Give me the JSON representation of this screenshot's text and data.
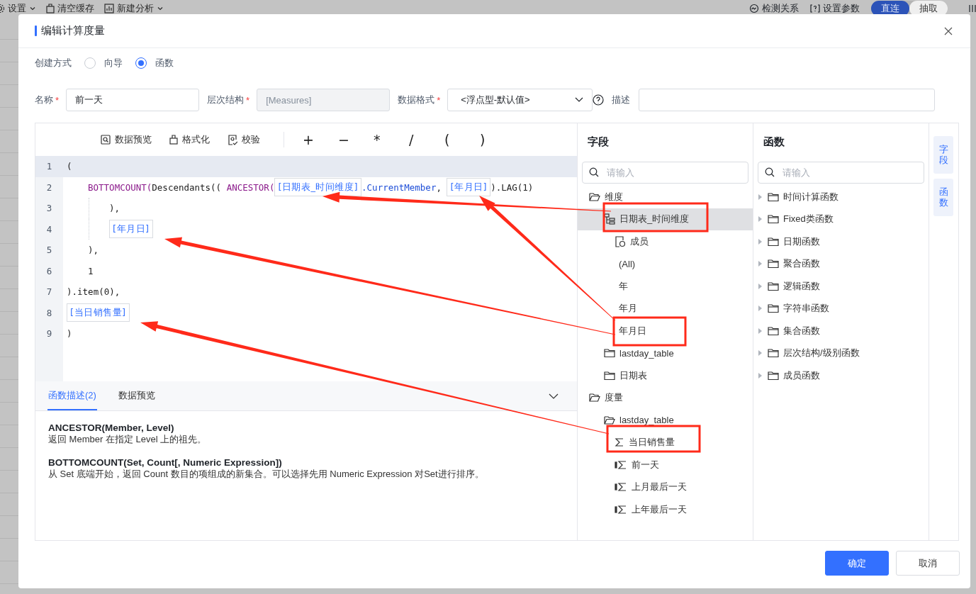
{
  "backdrop": {
    "toolbar_left": [
      {
        "label": "设置",
        "caret": true
      },
      {
        "label": "清空缓存",
        "caret": false
      },
      {
        "label": "新建分析",
        "caret": true
      }
    ],
    "toolbar_right": [
      {
        "label": "检测关系"
      },
      {
        "label": "设置参数"
      }
    ],
    "mode_toggle": [
      {
        "label": "直连",
        "selected": true
      },
      {
        "label": "抽取",
        "selected": false
      }
    ]
  },
  "dialog": {
    "title": "编辑计算度量"
  },
  "create_mode": {
    "label": "创建方式",
    "options": [
      {
        "label": "向导",
        "selected": false
      },
      {
        "label": "函数",
        "selected": true
      }
    ]
  },
  "form": [
    {
      "label": "名称",
      "mark": "*",
      "value": "前一天",
      "disabled": false,
      "kind": "input"
    },
    {
      "label": "层次结构",
      "mark": "*",
      "value": "[Measures]",
      "disabled": true,
      "kind": "input"
    },
    {
      "label": "数据格式",
      "mark": "*",
      "value": "<浮点型-默认值>",
      "disabled": false,
      "kind": "select"
    },
    {
      "label": "描述",
      "disabled": false,
      "kind": "input"
    }
  ],
  "editor": {
    "toolbar": [
      {
        "label": "数据预览"
      },
      {
        "label": "格式化"
      },
      {
        "label": "校验"
      }
    ],
    "operators": [
      "+",
      "−",
      "*",
      "/",
      "(",
      ")"
    ],
    "lines": [
      {
        "number": "1",
        "kind": "flat",
        "selected": true,
        "guide": false,
        "tokens": [
          {
            "kind": "plain",
            "text": "("
          }
        ]
      },
      {
        "number": "2",
        "kind": "indent",
        "selected": false,
        "guide": false,
        "tokens": [
          {
            "kind": "keyword",
            "text": "BOTTOMCOUNT("
          },
          {
            "kind": "plain",
            "text": "Descendants(( "
          },
          {
            "kind": "keyword",
            "text": "ANCESTOR("
          },
          {
            "kind": "field",
            "text": "[日期表_时间维度]"
          },
          {
            "kind": "method",
            "text": ".CurrentMember"
          },
          {
            "kind": "plain",
            "text": ", "
          },
          {
            "kind": "field",
            "text": "[年月日]"
          },
          {
            "kind": "plain",
            "text": ").LAG(1)"
          }
        ]
      },
      {
        "number": "3",
        "kind": "deep",
        "selected": false,
        "guide": true,
        "tokens": [
          {
            "kind": "plain",
            "text": "),"
          }
        ]
      },
      {
        "number": "4",
        "kind": "deep",
        "selected": false,
        "guide": true,
        "tokens": [
          {
            "kind": "field",
            "text": "[年月日]"
          }
        ]
      },
      {
        "number": "5",
        "kind": "indent",
        "selected": false,
        "guide": false,
        "tokens": [
          {
            "kind": "plain",
            "text": "),"
          }
        ]
      },
      {
        "number": "6",
        "kind": "indent",
        "selected": false,
        "guide": false,
        "tokens": [
          {
            "kind": "plain",
            "text": "1"
          }
        ]
      },
      {
        "number": "7",
        "kind": "flat",
        "selected": false,
        "guide": false,
        "tokens": [
          {
            "kind": "plain",
            "text": ").item(0),"
          }
        ]
      },
      {
        "number": "8",
        "kind": "flat",
        "selected": false,
        "guide": false,
        "tokens": [
          {
            "kind": "field",
            "text": "[当日销售量]"
          }
        ]
      },
      {
        "number": "9",
        "kind": "flat",
        "selected": false,
        "guide": false,
        "tokens": [
          {
            "kind": "plain",
            "text": ")"
          }
        ]
      }
    ]
  },
  "description": {
    "tabs": [
      {
        "label": "函数描述(2)",
        "selected": true
      },
      {
        "label": "数据预览",
        "selected": false
      }
    ],
    "entries": [
      {
        "signature": "ANCESTOR(Member, Level)",
        "text": "返回 Member 在指定 Level 上的祖先。"
      },
      {
        "signature": "BOTTOMCOUNT(Set, Count[, Numeric Expression])",
        "text": "从 Set 底端开始，返回 Count 数目的项组成的新集合。可以选择先用 Numeric Expression 对Set进行排序。"
      }
    ]
  },
  "fields": {
    "title": "字段",
    "search": {
      "placeholder": "请输入"
    },
    "tree": [
      {
        "label": "维度",
        "kind": "folder",
        "expanded": true,
        "selected": false,
        "children": [
          {
            "label": "日期表_时间维度",
            "kind": "hierarchy",
            "expanded": true,
            "selected": true,
            "children": [
              {
                "label": "成员",
                "kind": "member",
                "selected": false
              },
              {
                "label": "(All)",
                "kind": "level",
                "selected": false
              },
              {
                "label": "年",
                "kind": "level",
                "selected": false
              },
              {
                "label": "年月",
                "kind": "level",
                "selected": false
              },
              {
                "label": "年月日",
                "kind": "level",
                "selected": false
              }
            ]
          },
          {
            "label": "lastday_table",
            "kind": "folder",
            "expanded": false,
            "selected": false
          },
          {
            "label": "日期表",
            "kind": "folder",
            "expanded": false,
            "selected": false
          }
        ]
      },
      {
        "label": "度量",
        "kind": "folder",
        "expanded": true,
        "selected": false,
        "children": [
          {
            "label": "lastday_table",
            "kind": "folder",
            "expanded": true,
            "selected": false,
            "children": [
              {
                "label": "当日销售量",
                "kind": "measure",
                "selected": false
              },
              {
                "label": "前一天",
                "kind": "calc",
                "selected": false
              },
              {
                "label": "上月最后一天",
                "kind": "calc",
                "selected": false
              },
              {
                "label": "上年最后一天",
                "kind": "calc",
                "selected": false
              }
            ]
          }
        ]
      }
    ]
  },
  "functions": {
    "title": "函数",
    "search": {
      "placeholder": "请输入"
    },
    "categories": [
      {
        "label": "时间计算函数",
        "expanded": false
      },
      {
        "label": "Fixed类函数",
        "expanded": false
      },
      {
        "label": "日期函数",
        "expanded": false
      },
      {
        "label": "聚合函数",
        "expanded": false
      },
      {
        "label": "逻辑函数",
        "expanded": false
      },
      {
        "label": "字符串函数",
        "expanded": false
      },
      {
        "label": "集合函数",
        "expanded": false
      },
      {
        "label": "层次结构/级别函数",
        "expanded": false
      },
      {
        "label": "成员函数",
        "expanded": false
      }
    ]
  },
  "side_tabs": [
    {
      "label": "字段"
    },
    {
      "label": "函数"
    }
  ],
  "buttons": [
    {
      "label": "确定",
      "kind": "primary"
    },
    {
      "label": "取消",
      "kind": "default"
    }
  ]
}
